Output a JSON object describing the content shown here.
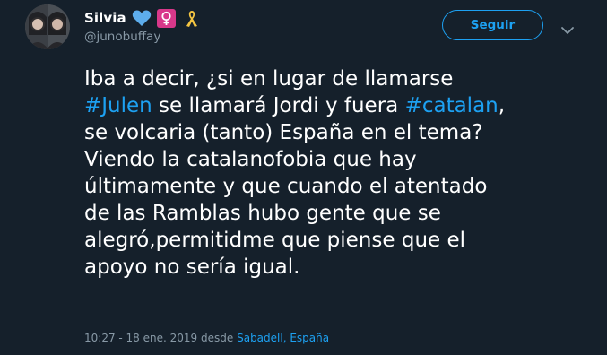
{
  "user": {
    "display_name": "Silvia",
    "handle": "@junobuffay",
    "name_emojis": [
      "blue-heart-icon",
      "female-sign-icon",
      "ribbon-icon"
    ]
  },
  "follow_button": {
    "label": "Seguir"
  },
  "tweet": {
    "lines": [
      [
        {
          "text": "Iba a decir, ¿si en lugar de llamarse",
          "hashtag": false
        }
      ],
      [
        {
          "text": "#Julen",
          "hashtag": true
        },
        {
          "text": " se llamará Jordi y fuera ",
          "hashtag": false
        },
        {
          "text": "#catalan",
          "hashtag": true
        },
        {
          "text": ",",
          "hashtag": false
        }
      ],
      [
        {
          "text": "se volcaria (tanto) España en el tema?",
          "hashtag": false
        }
      ],
      [
        {
          "text": "Viendo la catalanofobia que hay",
          "hashtag": false
        }
      ],
      [
        {
          "text": "últimamente y que cuando el atentado",
          "hashtag": false
        }
      ],
      [
        {
          "text": "de las Ramblas hubo gente que se",
          "hashtag": false
        }
      ],
      [
        {
          "text": "alegró,permitidme que piense que el",
          "hashtag": false
        }
      ],
      [
        {
          "text": "apoyo no sería igual.",
          "hashtag": false
        }
      ]
    ]
  },
  "meta": {
    "time_date": "10:27 - 18 ene. 2019",
    "from_label": "desde",
    "location": "Sabadell, España"
  },
  "colors": {
    "background": "#15202b",
    "accent": "#1da1f2",
    "secondary_text": "#8899a6",
    "primary_text": "#ffffff"
  }
}
